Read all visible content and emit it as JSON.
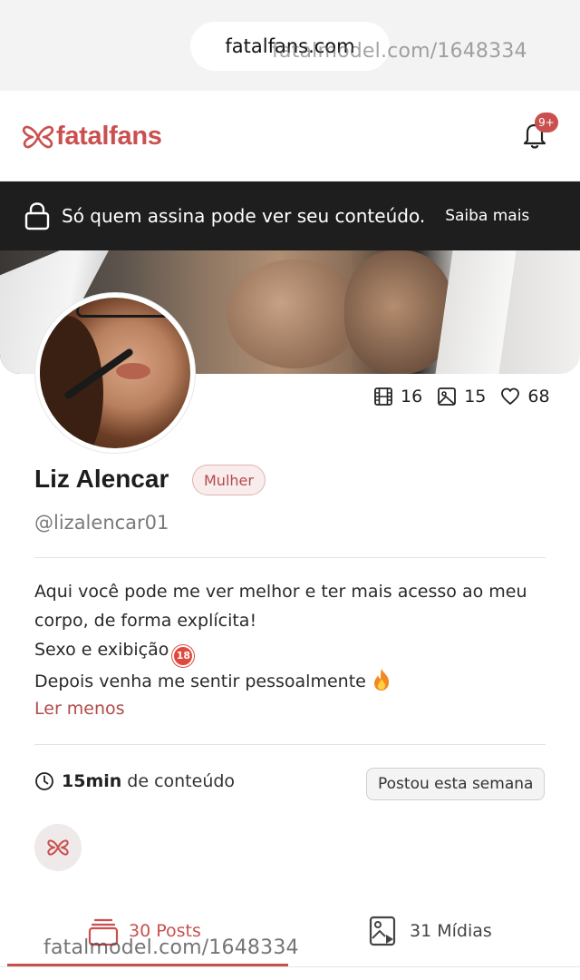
{
  "browser": {
    "url": "fatalfans.com",
    "watermark_top": "fatalmodel.com/1648334",
    "watermark_bottom": "fatalmodel.com/1648334"
  },
  "header": {
    "logo_text": "fatalfans",
    "notification_badge": "9+",
    "brand_color": "#c9504f"
  },
  "notice": {
    "text": "Só quem assina pode ver seu conteúdo.",
    "link": "Saiba mais"
  },
  "profile": {
    "stats": {
      "videos": "16",
      "photos": "15",
      "likes": "68"
    },
    "name": "Liz Alencar",
    "gender": "Mulher",
    "handle": "@lizalencar01",
    "bio": {
      "line1": "Aqui você pode me ver melhor e ter mais acesso ao meu",
      "line2": "corpo, de forma explícita!",
      "line3": "Sexo e exibição",
      "line3_emoji": "18",
      "line4": "Depois venha me sentir pessoalmente"
    },
    "read_less": "Ler menos",
    "content_duration": "15min",
    "content_suffix": "de conteúdo",
    "posted_badge": "Postou esta semana"
  },
  "tabs": {
    "posts": "30 Posts",
    "media": "31 Mídias",
    "active": "posts"
  }
}
